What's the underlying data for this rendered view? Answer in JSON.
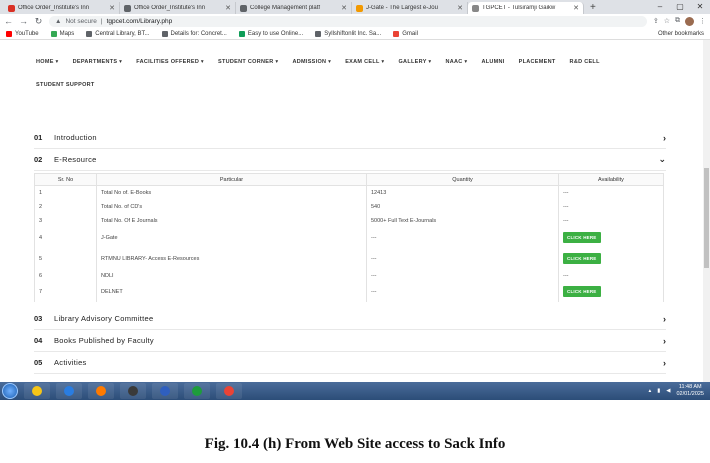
{
  "browser": {
    "tabs": [
      {
        "label": "Office Order_Institute's Inn",
        "fav_color": "#d93025",
        "active": false
      },
      {
        "label": "Office Order_Institute's Inn",
        "fav_color": "#5f6368",
        "active": false
      },
      {
        "label": "College Management platf",
        "fav_color": "#5f6368",
        "active": false
      },
      {
        "label": "J-Gate - The Largest e-Jou",
        "fav_color": "#f29900",
        "active": false
      },
      {
        "label": "TGPCET - Tulsiramji Gaikw",
        "fav_color": "#888888",
        "active": true
      }
    ],
    "new_tab": "+",
    "window_controls": [
      "–",
      "▢",
      "✕"
    ],
    "security": "Not secure",
    "url": "tgpcet.com/Library.php",
    "bookmarks": [
      "YouTube",
      "Maps",
      "Central Library, BT...",
      "Details for: Concret...",
      "Easy to use Online...",
      "Syllshiftonlit Inc. Sa...",
      "Gmail"
    ],
    "other_bookmarks": "Other bookmarks"
  },
  "site_nav": {
    "row1": [
      "HOME ▾",
      "DEPARTMENTS ▾",
      "FACILITIES OFFERED ▾",
      "STUDENT CORNER ▾",
      "ADMISSION ▾",
      "EXAM CELL ▾",
      "GALLERY ▾",
      "NAAC ▾",
      "ALUMNI",
      "PLACEMENT",
      "R&D CELL"
    ],
    "row2": "STUDENT SUPPORT"
  },
  "accordion_top": [
    {
      "num": "01",
      "title": "Introduction",
      "chev": "›"
    },
    {
      "num": "02",
      "title": "E-Resource",
      "chev": "⌄"
    }
  ],
  "eresource_table": {
    "headers": [
      "Sr. No",
      "Particular",
      "Quantity",
      "Availability"
    ],
    "rows": [
      {
        "sr": "1",
        "particular": "Total No of. E-Books",
        "quantity": "12413",
        "availability": "---",
        "button": ""
      },
      {
        "sr": "2",
        "particular": "Total No. of CD's",
        "quantity": "540",
        "availability": "---",
        "button": ""
      },
      {
        "sr": "3",
        "particular": "Total No. Of E Journals",
        "quantity": "5000+ Full Text E-Journals",
        "availability": "---",
        "button": ""
      },
      {
        "sr": "4",
        "particular": "J-Gate",
        "quantity": "---",
        "availability": "",
        "button": "CLICK HERE"
      },
      {
        "sr": "5",
        "particular": "RTMNU LIBRARY- Access E-Resources",
        "quantity": "---",
        "availability": "",
        "button": "CLICK HERE"
      },
      {
        "sr": "6",
        "particular": "NDLI",
        "quantity": "---",
        "availability": "---",
        "button": ""
      },
      {
        "sr": "7",
        "particular": "DELNET",
        "quantity": "---",
        "availability": "",
        "button": "CLICK HERE"
      }
    ]
  },
  "accordion_bottom": [
    {
      "num": "03",
      "title": "Library Advisory Committee",
      "chev": "›"
    },
    {
      "num": "04",
      "title": "Books Published by Faculty",
      "chev": "›"
    },
    {
      "num": "05",
      "title": "Activities",
      "chev": "›"
    }
  ],
  "taskbar": {
    "time": "11:48 AM",
    "date": "02/01/2025",
    "apps": [
      "#f5c518",
      "#2a7de1",
      "#ff7a00",
      "#3a3a3a",
      "#2f5fbf",
      "#1e9c3c",
      "#ea4335"
    ]
  },
  "caption": "Fig. 10.4 (h) From Web Site access to Sack Info"
}
